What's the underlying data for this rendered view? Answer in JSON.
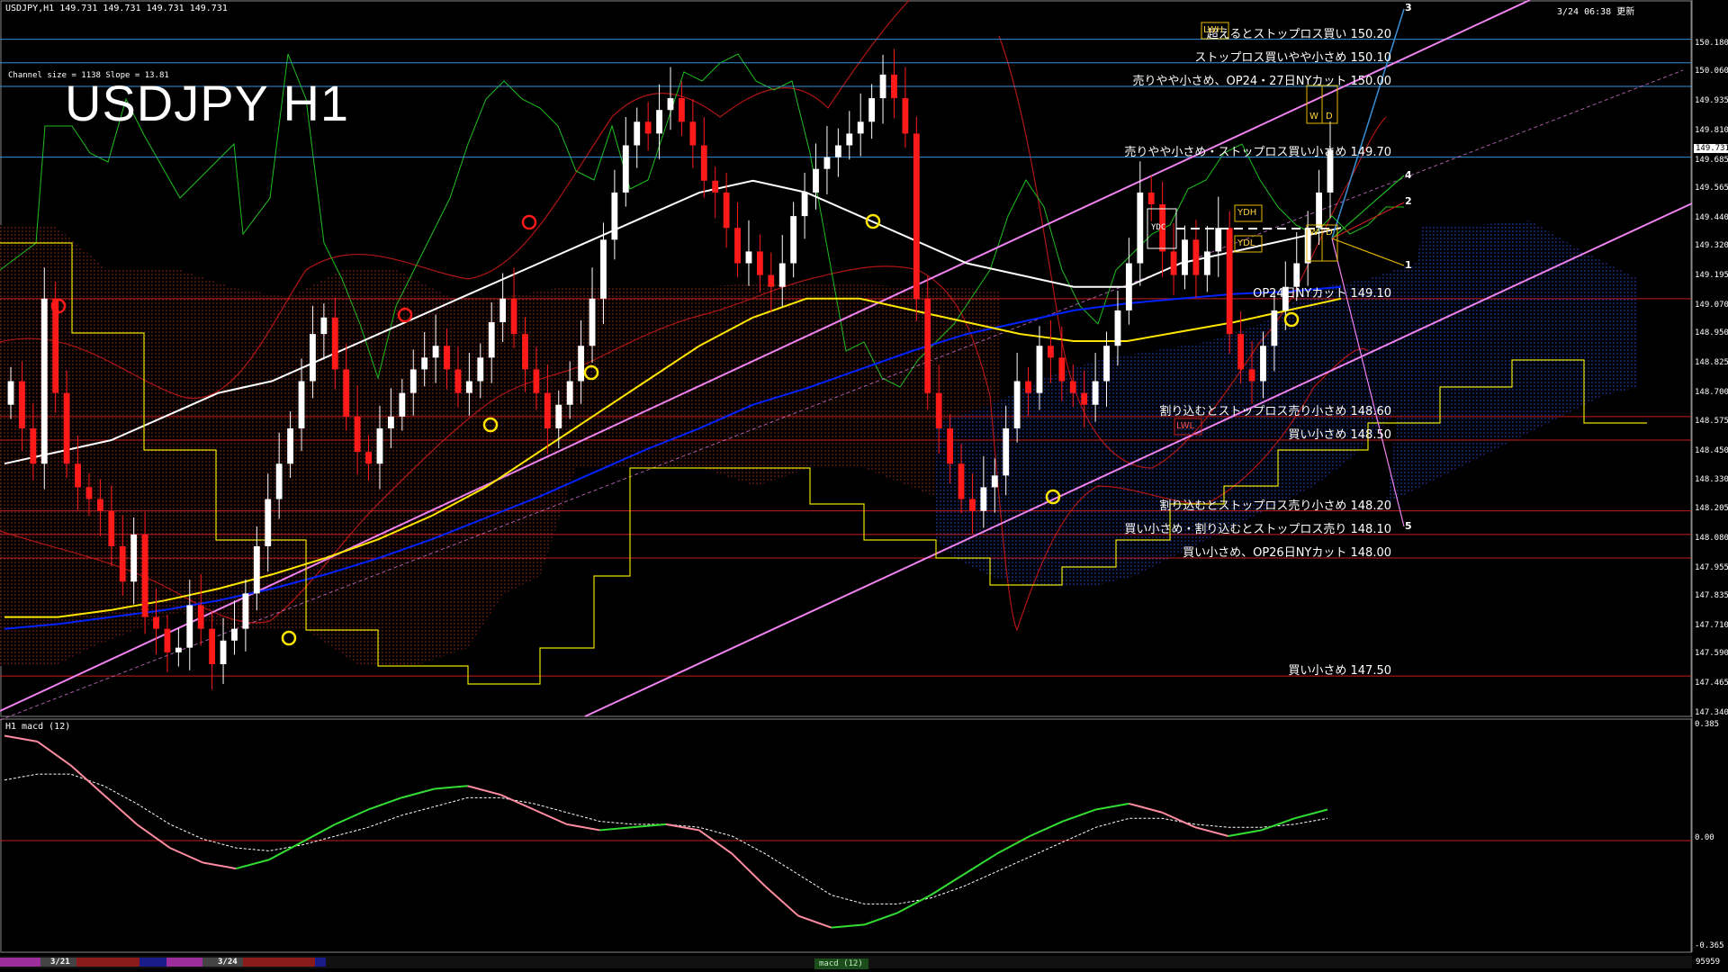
{
  "header": {
    "symbol_line": "USDJPY,H1  149.731 149.731 149.731 149.731",
    "updated": "3/24 06:38 更新",
    "channel_info": "Channel size = 1138 Slope = 13.81",
    "title": "USDJPY H1",
    "subwindow_title": "H1  macd (12)"
  },
  "chart_data": {
    "type": "line",
    "symbol": "USDJPY",
    "timeframe": "H1",
    "title": "USDJPY H1",
    "ylim": [
      147.34,
      150.29
    ],
    "price_ticks": [
      "150.180",
      "150.060",
      "149.935",
      "149.810",
      "149.685",
      "149.565",
      "149.440",
      "149.320",
      "149.195",
      "149.070",
      "148.950",
      "148.825",
      "148.700",
      "148.575",
      "148.450",
      "148.330",
      "148.205",
      "148.080",
      "147.955",
      "147.835",
      "147.710",
      "147.590",
      "147.465",
      "147.340"
    ],
    "current_price": "149.731",
    "levels": [
      {
        "price": 150.2,
        "text": "超えるとストップロス買い 150.20",
        "color": "#3a8fd6"
      },
      {
        "price": 150.1,
        "text": "ストップロス買いやや小さめ 150.10",
        "color": "#3a8fd6"
      },
      {
        "price": 150.0,
        "text": "売りやや小さめ、OP24・27日NYカット 150.00",
        "color": "#3a8fd6"
      },
      {
        "price": 149.7,
        "text": "売りやや小さめ・ストップロス買い小さめ 149.70",
        "color": "#3a8fd6"
      },
      {
        "price": 149.1,
        "text": "OP24日NYカット 149.10",
        "color": "#c81e1e"
      },
      {
        "price": 148.6,
        "text": "割り込むとストップロス売り小さめ 148.60",
        "color": "#c81e1e"
      },
      {
        "price": 148.5,
        "text": "買い小さめ 148.50",
        "color": "#c81e1e"
      },
      {
        "price": 148.2,
        "text": "割り込むとストップロス売り小さめ 148.20",
        "color": "#c81e1e"
      },
      {
        "price": 148.1,
        "text": "買い小さめ・割り込むとストップロス売り 148.10",
        "color": "#c81e1e"
      },
      {
        "price": 148.0,
        "text": "買い小さめ、OP26日NYカット 148.00",
        "color": "#c81e1e"
      },
      {
        "price": 147.5,
        "text": "買い小さめ 147.50",
        "color": "#c81e1e"
      }
    ],
    "projection_labels": [
      "1",
      "2",
      "3",
      "4",
      "5"
    ],
    "boxes": {
      "lwh": "LWH",
      "lwl": "LWL",
      "ydh": "YDH",
      "ydl": "YDL",
      "ydc": "YDC",
      "w": "W",
      "d": "D"
    },
    "closes": [
      148.75,
      148.55,
      148.4,
      149.1,
      148.7,
      148.4,
      148.3,
      148.25,
      148.2,
      148.05,
      147.9,
      148.1,
      147.75,
      147.7,
      147.6,
      147.62,
      147.8,
      147.7,
      147.55,
      147.65,
      147.7,
      147.85,
      148.05,
      148.25,
      148.4,
      148.55,
      148.75,
      148.95,
      149.02,
      148.8,
      148.6,
      148.45,
      148.4,
      148.55,
      148.6,
      148.7,
      148.8,
      148.85,
      148.9,
      148.8,
      148.7,
      148.75,
      148.85,
      149.0,
      149.1,
      148.95,
      148.8,
      148.7,
      148.55,
      148.65,
      148.75,
      148.9,
      149.1,
      149.35,
      149.55,
      149.75,
      149.85,
      149.8,
      149.9,
      149.95,
      149.85,
      149.75,
      149.6,
      149.55,
      149.4,
      149.25,
      149.3,
      149.2,
      149.15,
      149.25,
      149.45,
      149.55,
      149.65,
      149.7,
      149.75,
      149.8,
      149.85,
      149.95,
      150.05,
      149.95,
      149.8,
      149.1,
      148.7,
      148.55,
      148.4,
      148.25,
      148.2,
      148.3,
      148.35,
      148.55,
      148.75,
      148.7,
      148.9,
      148.85,
      148.75,
      148.7,
      148.65,
      148.75,
      148.9,
      149.05,
      149.25,
      149.55,
      149.5,
      149.3,
      149.2,
      149.35,
      149.2,
      149.3,
      149.4,
      148.95,
      148.8,
      148.75,
      148.9,
      149.05,
      149.15,
      149.25,
      149.4,
      149.55,
      149.731
    ],
    "ema_fast": [
      148.4,
      148.45,
      148.5,
      148.6,
      148.7,
      148.75,
      148.85,
      148.95,
      149.05,
      149.15,
      149.25,
      149.35,
      149.45,
      149.55,
      149.6,
      149.55,
      149.45,
      149.35,
      149.25,
      149.2,
      149.15,
      149.15,
      149.25,
      149.3,
      149.35,
      149.4
    ],
    "ema_mid": [
      147.75,
      147.75,
      147.78,
      147.82,
      147.87,
      147.93,
      148.0,
      148.08,
      148.18,
      148.3,
      148.45,
      148.6,
      148.75,
      148.9,
      149.02,
      149.1,
      149.1,
      149.05,
      149.0,
      148.95,
      148.92,
      148.92,
      148.96,
      149.0,
      149.05,
      149.1
    ],
    "ema_slow": [
      147.7,
      147.72,
      147.75,
      147.78,
      147.82,
      147.87,
      147.93,
      148.0,
      148.08,
      148.17,
      148.26,
      148.36,
      148.46,
      148.55,
      148.65,
      148.72,
      148.8,
      148.88,
      148.95,
      149.0,
      149.05,
      149.08,
      149.1,
      149.12,
      149.13,
      149.15
    ],
    "macd": {
      "ylim": [
        -0.365,
        0.385
      ],
      "ticks": [
        "0.385",
        "0.00",
        "-0.365"
      ],
      "main": [
        0.35,
        0.33,
        0.25,
        0.15,
        0.05,
        -0.03,
        -0.08,
        -0.1,
        -0.07,
        -0.01,
        0.05,
        0.1,
        0.14,
        0.17,
        0.18,
        0.15,
        0.1,
        0.05,
        0.03,
        0.04,
        0.05,
        0.03,
        -0.05,
        -0.16,
        -0.26,
        -0.3,
        -0.29,
        -0.25,
        -0.19,
        -0.12,
        -0.05,
        0.01,
        0.06,
        0.1,
        0.12,
        0.09,
        0.04,
        0.01,
        0.03,
        0.07,
        0.1
      ],
      "signal": [
        0.2,
        0.22,
        0.22,
        0.18,
        0.12,
        0.05,
        0.0,
        -0.03,
        -0.04,
        -0.02,
        0.01,
        0.04,
        0.08,
        0.11,
        0.14,
        0.14,
        0.12,
        0.09,
        0.06,
        0.05,
        0.05,
        0.04,
        0.01,
        -0.05,
        -0.12,
        -0.19,
        -0.22,
        -0.22,
        -0.2,
        -0.16,
        -0.11,
        -0.06,
        -0.01,
        0.04,
        0.07,
        0.07,
        0.05,
        0.04,
        0.04,
        0.05,
        0.07
      ]
    },
    "date_labels": [
      "3/21",
      "3/24"
    ],
    "bottom_label": "macd (12)",
    "volume_label": "95959"
  },
  "colors": {
    "bull": "#ffffff",
    "bear": "#ff1a1a",
    "resistance": "#3a8fd6",
    "support": "#c81e1e",
    "channel": "#ee82ee",
    "ema_fast": "#ffffff",
    "ema_mid": "#ffe600",
    "ema_slow": "#0022ff",
    "kumo_bear": "#8b2a1f",
    "kumo_bull": "#1c2f8a",
    "macd_up": "#33dd33",
    "macd_down": "#ff8ca0"
  }
}
